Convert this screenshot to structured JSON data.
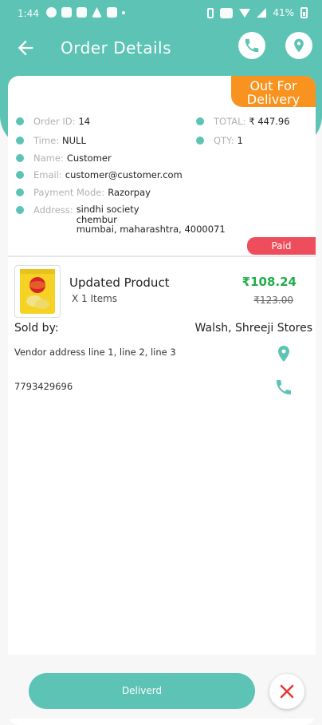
{
  "status_bar": {
    "time": "1:44",
    "battery": "41%"
  },
  "header": {
    "title": "Order Details"
  },
  "order": {
    "status": "Out For Delivery",
    "order_id_label": "Order ID:",
    "order_id": "14",
    "total_label": "TOTAL:",
    "total": "₹ 447.96",
    "time_label": "Time:",
    "time": "NULL",
    "qty_label": "QTY:",
    "qty": "1",
    "name_label": "Name:",
    "name": "Customer",
    "email_label": "Email:",
    "email": "customer@customer.com",
    "payment_label": "Payment Mode:",
    "payment_mode": "Razorpay",
    "address_label": "Address:",
    "address_line1": "sindhi society",
    "address_line2": "chembur",
    "address_line3": "mumbai, maharashtra, 4000071",
    "payment_status": "Paid"
  },
  "product": {
    "name": "Updated Product",
    "qty": "X 1 Items",
    "price": "₹108.24",
    "mrp": "₹123.00",
    "image_brand": "Lay's"
  },
  "vendor": {
    "sold_by_label": "Sold by:",
    "name": "Walsh, Shreeji Stores",
    "address": "Vendor address line 1, line 2, line 3",
    "phone": "7793429696"
  },
  "actions": {
    "deliver_label": "Deliverd"
  },
  "colors": {
    "primary": "#5cc3b5",
    "status_orange": "#f7931e",
    "paid_red": "#ee4d5b",
    "price_green": "#22ad4b"
  },
  "icons": [
    "back-arrow-icon",
    "phone-icon",
    "location-pin-icon",
    "close-icon"
  ]
}
